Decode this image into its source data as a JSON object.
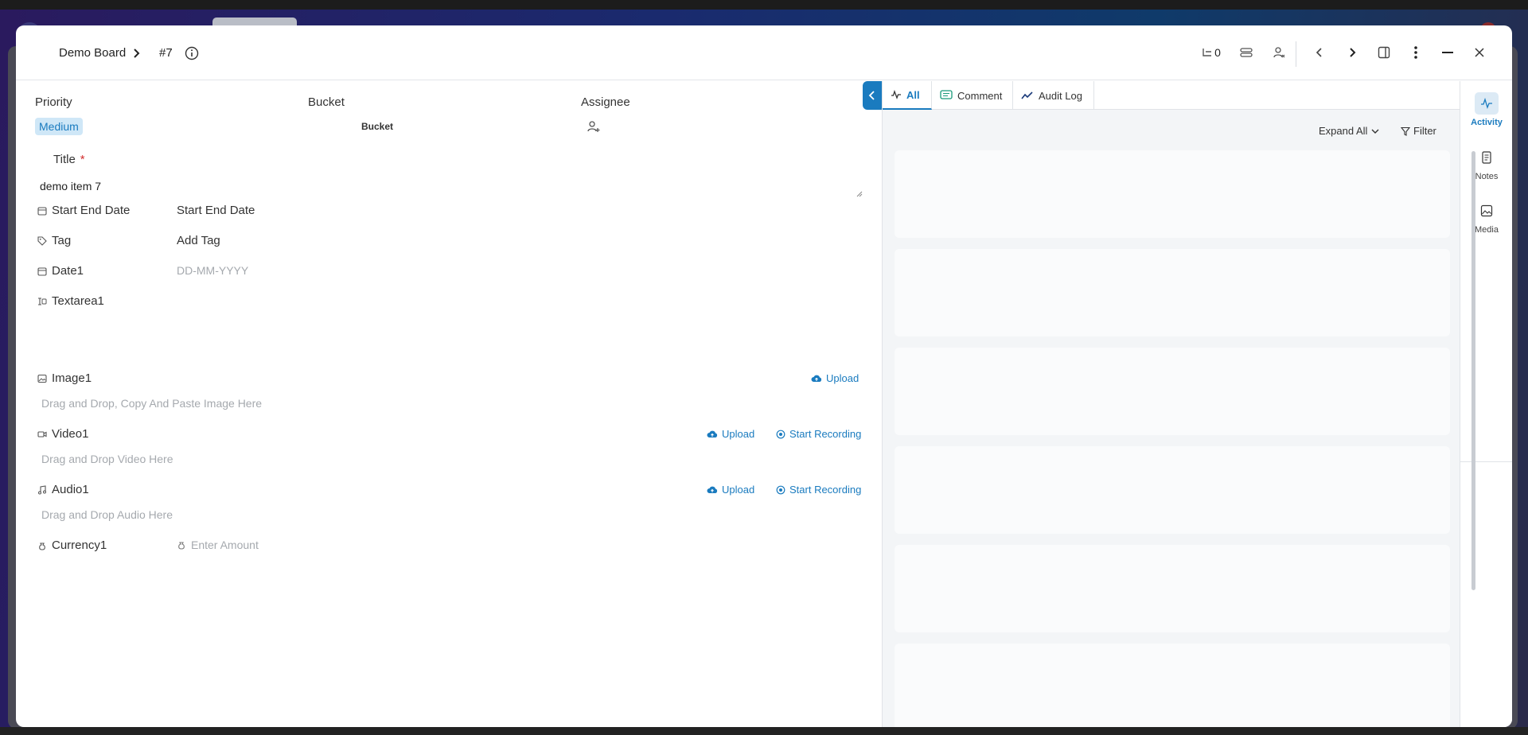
{
  "header": {
    "board": "Demo Board",
    "item_id": "#7",
    "counter": "0"
  },
  "fields": {
    "priority_label": "Priority",
    "priority_value": "Medium",
    "bucket_label": "Bucket",
    "bucket_value": "Bucket",
    "assignee_label": "Assignee",
    "title_label": "Title",
    "title_required": "*",
    "title_value": "demo item 7",
    "start_end_label": "Start End Date",
    "start_end_value": "Start End Date",
    "tag_label": "Tag",
    "tag_value": "Add Tag",
    "date1_label": "Date1",
    "date1_placeholder": "DD-MM-YYYY",
    "textarea1_label": "Textarea1",
    "image1_label": "Image1",
    "image1_hint": "Drag and Drop, Copy And Paste Image Here",
    "video1_label": "Video1",
    "video1_hint": "Drag and Drop Video Here",
    "audio1_label": "Audio1",
    "audio1_hint": "Drag and Drop Audio Here",
    "currency1_label": "Currency1",
    "currency1_placeholder": "Enter Amount",
    "upload": "Upload",
    "start_recording": "Start Recording"
  },
  "panel": {
    "tabs": [
      "All",
      "Comment",
      "Audit Log"
    ],
    "expand_all": "Expand All",
    "filter": "Filter"
  },
  "rail": [
    "Activity",
    "Notes",
    "Media"
  ],
  "colors": {
    "accent": "#1a7bbf",
    "badge_bg": "#cfe7f7",
    "required": "#d32f2f"
  }
}
